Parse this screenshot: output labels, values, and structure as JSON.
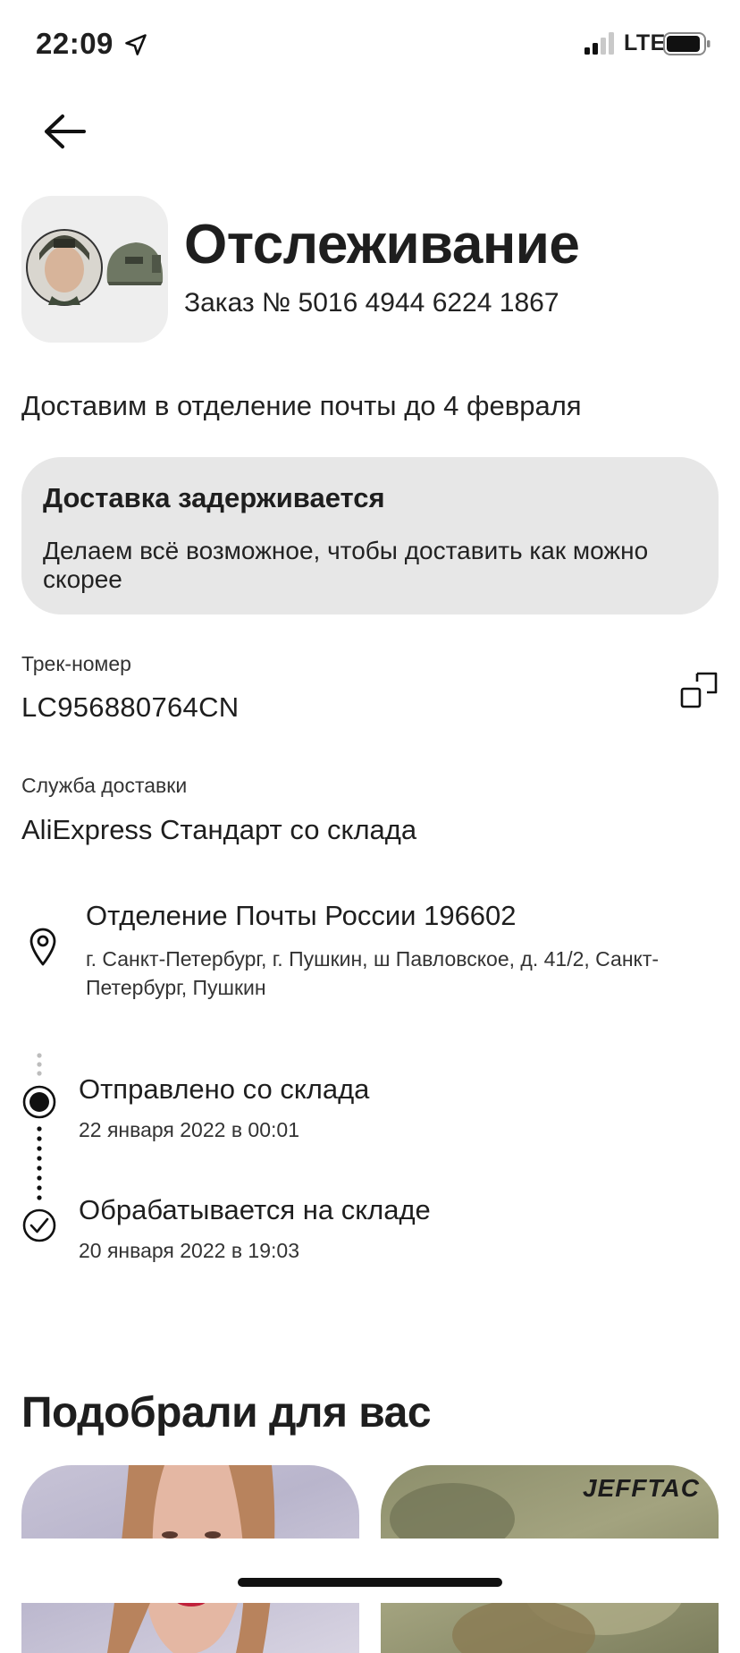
{
  "status_bar": {
    "time": "22:09",
    "network": "LTE"
  },
  "header": {
    "title": "Отслеживание",
    "order": "Заказ № 5016 4944 6224 1867"
  },
  "delivery": {
    "estimate": "Доставим в отделение почты до 4 февраля"
  },
  "alert": {
    "title": "Доставка задерживается",
    "text": "Делаем всё возможное, чтобы доставить как можно скорее"
  },
  "tracking": {
    "label": "Трек-номер",
    "number": "LC956880764CN"
  },
  "service": {
    "label": "Служба доставки",
    "value": "AliExpress Стандарт со склада"
  },
  "pickup": {
    "name": "Отделение Почты России 196602",
    "address": "г. Санкт-Петербург, г. Пушкин, ш Павловское, д. 41/2, Санкт-Петербург, Пушкин"
  },
  "events": [
    {
      "title": "Отправлено со склада",
      "date": "22 января 2022 в 00:01"
    },
    {
      "title": "Обрабатывается на складе",
      "date": "20 января 2022 в 19:03"
    }
  ],
  "recommendations": {
    "title": "Подобрали для вас",
    "card2_brand": "JEFFTAC"
  },
  "icons": [
    "location-arrow-icon",
    "signal-icon",
    "battery-icon",
    "back-arrow-icon",
    "copy-icon",
    "map-pin-icon",
    "timeline-current-dot-icon",
    "timeline-check-icon"
  ],
  "colors": {
    "alert_bg": "#e7e7e7",
    "thumb_bg": "#eeeeee",
    "text": "#1e1e1e"
  }
}
